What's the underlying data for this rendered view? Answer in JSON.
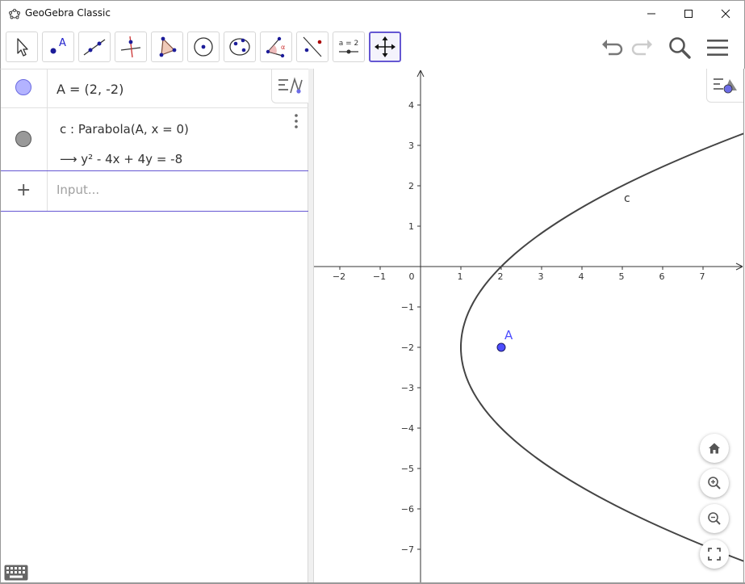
{
  "window": {
    "title": "GeoGebra Classic"
  },
  "toolbar": {
    "tools": [
      {
        "name": "move-tool",
        "icon": "arrow-cursor-icon"
      },
      {
        "name": "point-tool",
        "icon": "point-icon",
        "label": "A"
      },
      {
        "name": "line-tool",
        "icon": "line-icon"
      },
      {
        "name": "perpendicular-line-tool",
        "icon": "perpendicular-icon"
      },
      {
        "name": "polygon-tool",
        "icon": "polygon-icon"
      },
      {
        "name": "circle-tool",
        "icon": "circle-icon"
      },
      {
        "name": "ellipse-tool",
        "icon": "ellipse-icon"
      },
      {
        "name": "angle-tool",
        "icon": "angle-icon",
        "label": "α"
      },
      {
        "name": "reflect-tool",
        "icon": "reflect-icon"
      },
      {
        "name": "slider-tool",
        "icon": "slider-icon",
        "label": "a = 2"
      },
      {
        "name": "move-graphics-view-tool",
        "icon": "move-cross-icon",
        "selected": true
      }
    ]
  },
  "algebra": {
    "items": [
      {
        "label": "A = (2, -2)",
        "color": "#b3b3ff"
      },
      {
        "definition": "c : Parabola(A, x = 0)",
        "value": "⟶   y² - 4x + 4y = -8",
        "color": "#999999"
      }
    ],
    "input_placeholder": "Input..."
  },
  "graphics": {
    "x_ticks": [
      "−2",
      "−1",
      "0",
      "1",
      "2",
      "3",
      "4",
      "5",
      "6",
      "7"
    ],
    "y_ticks_pos": [
      "1",
      "2",
      "3",
      "4"
    ],
    "y_ticks_neg": [
      "−1",
      "−2",
      "−3",
      "−4",
      "−5",
      "−6",
      "−7"
    ],
    "point_label": "A",
    "curve_label": "c",
    "point_color": "#4d4dff",
    "curve_color": "#444444"
  },
  "chart_data": {
    "type": "line",
    "title": "",
    "xlabel": "",
    "ylabel": "",
    "xlim": [
      -2.6,
      8
    ],
    "ylim": [
      -7.8,
      4.9
    ],
    "grid": false,
    "series": [
      {
        "name": "c",
        "equation": "y² - 4x + 4y = -8",
        "x": [
          1,
          1.25,
          2,
          3.25,
          5,
          7.25,
          8
        ],
        "y": [
          -2,
          -3,
          -4,
          -5,
          -6,
          -7,
          -7.29
        ]
      }
    ],
    "points": [
      {
        "name": "A",
        "x": 2,
        "y": -2
      }
    ]
  }
}
